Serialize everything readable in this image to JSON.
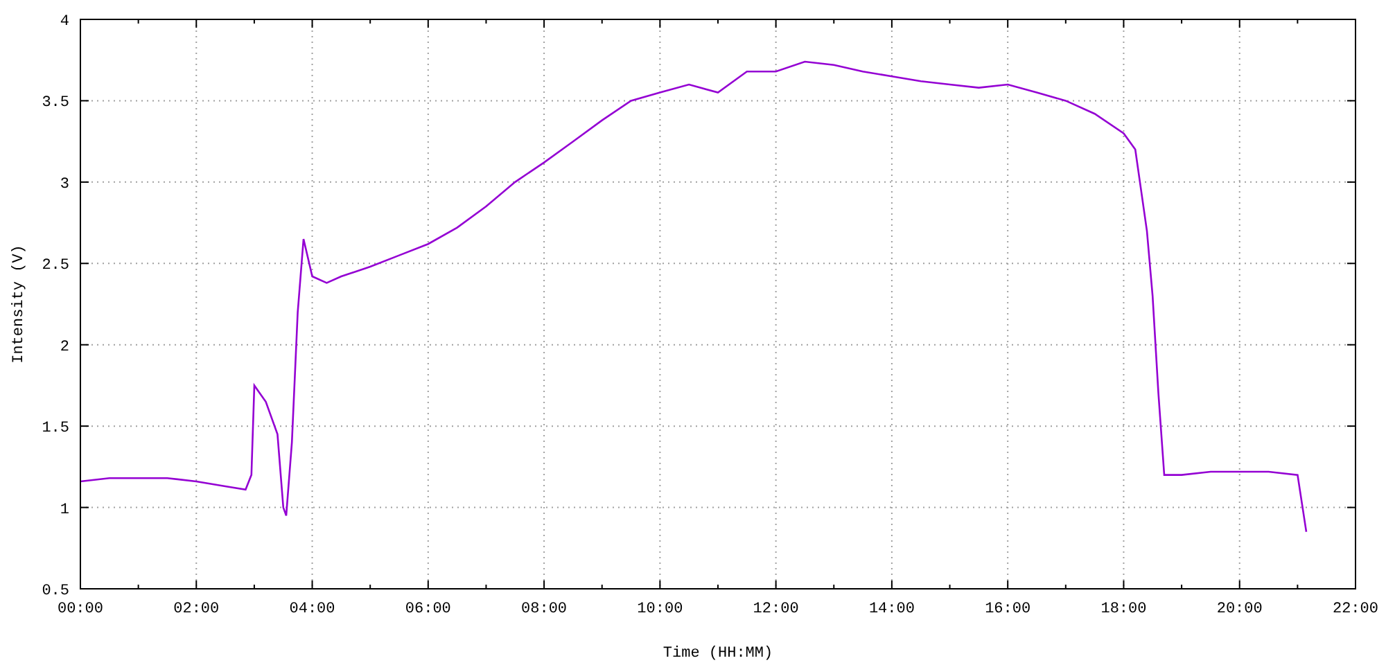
{
  "chart_data": {
    "type": "line",
    "xlabel": "Time (HH:MM)",
    "ylabel": "Intensity (V)",
    "grid": true,
    "xlim": [
      0,
      22
    ],
    "ylim": [
      0.5,
      4
    ],
    "xticks": [
      {
        "value": 0,
        "label": "00:00"
      },
      {
        "value": 2,
        "label": "02:00"
      },
      {
        "value": 4,
        "label": "04:00"
      },
      {
        "value": 6,
        "label": "06:00"
      },
      {
        "value": 8,
        "label": "08:00"
      },
      {
        "value": 10,
        "label": "10:00"
      },
      {
        "value": 12,
        "label": "12:00"
      },
      {
        "value": 14,
        "label": "14:00"
      },
      {
        "value": 16,
        "label": "16:00"
      },
      {
        "value": 18,
        "label": "18:00"
      },
      {
        "value": 20,
        "label": "20:00"
      },
      {
        "value": 22,
        "label": "22:00"
      }
    ],
    "yticks": [
      0.5,
      1,
      1.5,
      2,
      2.5,
      3,
      3.5,
      4
    ],
    "x": [
      0,
      0.5,
      1,
      1.5,
      2,
      2.5,
      2.85,
      2.95,
      3.0,
      3.2,
      3.4,
      3.5,
      3.55,
      3.65,
      3.75,
      3.85,
      4.0,
      4.25,
      4.5,
      5,
      5.5,
      6,
      6.5,
      7,
      7.5,
      8,
      8.5,
      9,
      9.5,
      10,
      10.5,
      11,
      11.5,
      12,
      12.5,
      13,
      13.5,
      14,
      14.5,
      15,
      15.5,
      16,
      16.5,
      17,
      17.5,
      18,
      18.2,
      18.4,
      18.5,
      18.6,
      18.7,
      19,
      19.5,
      20,
      20.5,
      21,
      21.15
    ],
    "series": [
      {
        "color": "#9400d3",
        "values": [
          1.16,
          1.18,
          1.18,
          1.18,
          1.16,
          1.13,
          1.11,
          1.2,
          1.75,
          1.65,
          1.45,
          1.0,
          0.95,
          1.4,
          2.2,
          2.65,
          2.42,
          2.38,
          2.42,
          2.48,
          2.55,
          2.62,
          2.72,
          2.85,
          3.0,
          3.12,
          3.25,
          3.38,
          3.5,
          3.55,
          3.6,
          3.55,
          3.68,
          3.68,
          3.74,
          3.72,
          3.68,
          3.65,
          3.62,
          3.6,
          3.58,
          3.6,
          3.55,
          3.5,
          3.42,
          3.3,
          3.2,
          2.7,
          2.3,
          1.7,
          1.2,
          1.2,
          1.22,
          1.22,
          1.22,
          1.2,
          0.85
        ]
      }
    ]
  }
}
